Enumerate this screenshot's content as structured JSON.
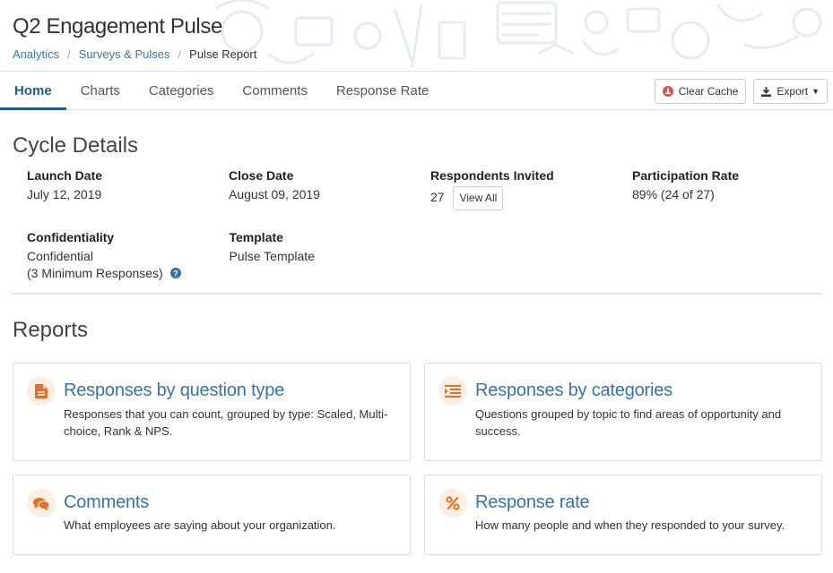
{
  "header": {
    "title": "Q2 Engagement Pulse",
    "breadcrumb": [
      {
        "label": "Analytics"
      },
      {
        "label": "Surveys & Pulses"
      },
      {
        "label": "Pulse Report"
      }
    ]
  },
  "tabs": [
    {
      "label": "Home",
      "active": true
    },
    {
      "label": "Charts"
    },
    {
      "label": "Categories"
    },
    {
      "label": "Comments"
    },
    {
      "label": "Response Rate"
    }
  ],
  "actions": {
    "clear_cache": "Clear Cache",
    "export": "Export"
  },
  "cycle": {
    "title": "Cycle Details",
    "launch_label": "Launch Date",
    "launch_value": "July 12, 2019",
    "close_label": "Close Date",
    "close_value": "August 09, 2019",
    "invited_label": "Respondents Invited",
    "invited_value": "27",
    "view_all": "View All",
    "participation_label": "Participation Rate",
    "participation_value": "89% (24 of 27)",
    "confidentiality_label": "Confidentiality",
    "confidentiality_value": "Confidential",
    "confidentiality_note": "(3 Minimum Responses)",
    "template_label": "Template",
    "template_value": "Pulse Template"
  },
  "reports": {
    "title": "Reports",
    "cards": [
      {
        "title": "Responses by question type",
        "desc": "Responses that you can count, grouped by type: Scaled, Multi-choice, Rank & NPS.",
        "icon": "document-icon"
      },
      {
        "title": "Responses by categories",
        "desc": "Questions grouped by topic to find areas of opportunity and success.",
        "icon": "indent-list-icon"
      },
      {
        "title": "Comments",
        "desc": "What employees are saying about your organization.",
        "icon": "comments-icon"
      },
      {
        "title": "Response rate",
        "desc": "How many people and when they responded to your survey.",
        "icon": "percent-icon"
      }
    ]
  },
  "colors": {
    "accent": "#1f5f8e",
    "link": "#3474a8",
    "icon_orange": "#e0702a",
    "icon_bg": "#fdeee3"
  }
}
